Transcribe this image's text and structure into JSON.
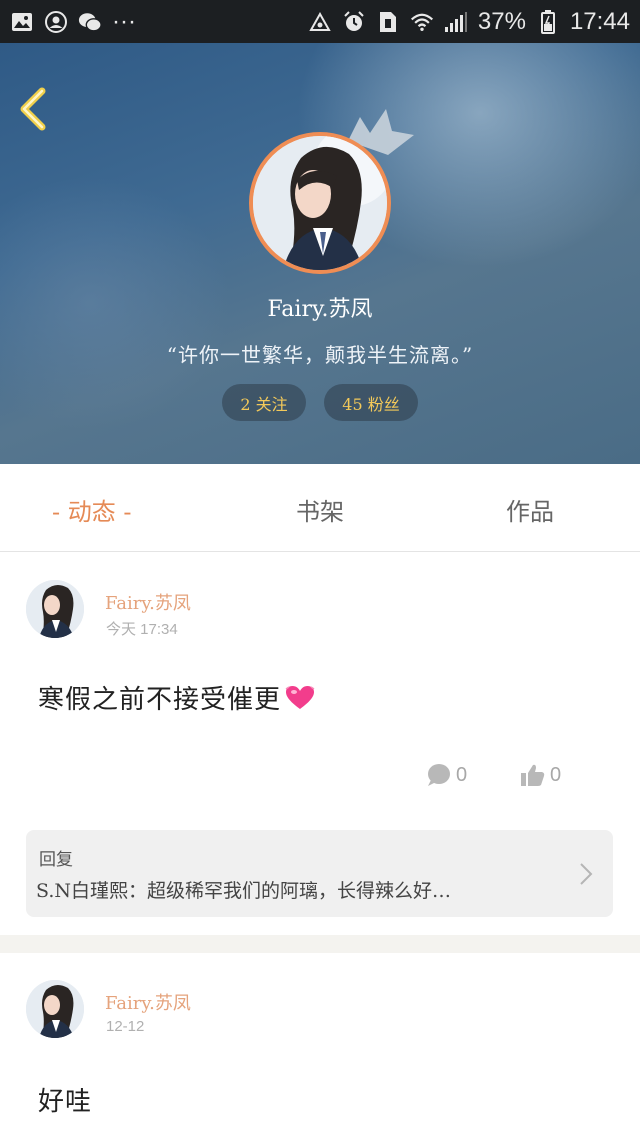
{
  "status_bar": {
    "icons_left": [
      "gallery-icon",
      "account-icon",
      "wechat-icon",
      "more-dots-icon"
    ],
    "more_dots": "···",
    "icons_right": [
      "sync-icon",
      "alarm-icon",
      "sim-icon",
      "wifi-icon",
      "signal-icon"
    ],
    "battery": "37%",
    "time": "17:44"
  },
  "profile": {
    "name": "Fairy.苏凤",
    "motto": "“许你一世繁华，颠我半生流离。”",
    "follow_label": "2 关注",
    "fans_label": "45 粉丝",
    "accent_color": "#ef8d54"
  },
  "tabs": [
    {
      "label": "- 动态 -",
      "active": true
    },
    {
      "label": "书架",
      "active": false
    },
    {
      "label": "作品",
      "active": false
    }
  ],
  "posts": [
    {
      "author": "Fairy.苏凤",
      "time": "今天 17:34",
      "text": "寒假之前不接受催更",
      "emoji": "heart-icon",
      "comments": "0",
      "likes": "0",
      "reply": {
        "title": "回复",
        "text": "S.N白瑾熙：超级稀罕我们的阿璃，长得辣么好…"
      }
    },
    {
      "author": "Fairy.苏凤",
      "time": "12-12",
      "text": "好哇"
    }
  ]
}
